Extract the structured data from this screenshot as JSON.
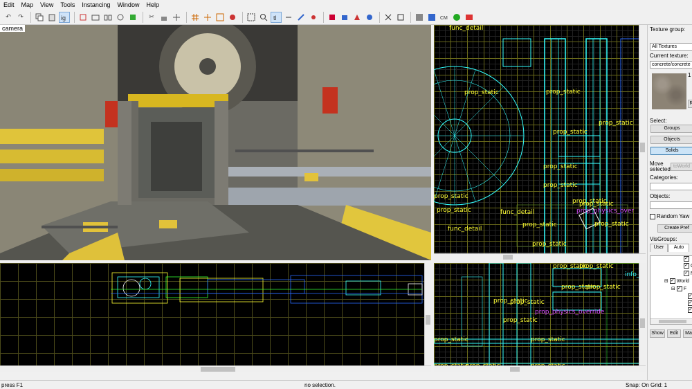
{
  "menu": [
    "Edit",
    "Map",
    "View",
    "Tools",
    "Instancing",
    "Window",
    "Help"
  ],
  "viewports": {
    "camera": {
      "label": "camera"
    },
    "top": {
      "labels": [
        "func_detail",
        "prop_static",
        "prop_static",
        "prop_static",
        "prop_static",
        "prop_static",
        "prop_static",
        "prop_static",
        "prop_static",
        "func_detail",
        "func_detail",
        "prop_static",
        "prop_static",
        "prop_static",
        "prop_static",
        "prop_static"
      ],
      "magenta_labels": [
        "prop_physics_over"
      ]
    },
    "side": {
      "labels": [
        "prop_static",
        "prop_static",
        "prop_static",
        "prop_static",
        "prop_static",
        "prop_static",
        "prop_static",
        "prop_static",
        "prop_static",
        "prop_static",
        "prop_static",
        "prop_static"
      ],
      "magenta_labels": [
        "prop_physics_override"
      ],
      "cyan_labels": [
        "info_plac"
      ]
    }
  },
  "side_panel": {
    "texture_group_label": "Texture group:",
    "texture_group_value": "All Textures",
    "current_texture_label": "Current texture:",
    "current_texture_value": "concrete/concrete",
    "texture_size": "1",
    "select_label": "Select:",
    "select_buttons": [
      "Groups",
      "Objects",
      "Solids"
    ],
    "move_selected_label_1": "Move",
    "move_selected_label_2": "selected",
    "to_world_button": "toWorld",
    "categories_label": "Categories:",
    "objects_label": "Objects:",
    "random_yaw_label": "Random Yaw",
    "create_prefab_button": "Create Pref",
    "visgroups_label": "VisGroups:",
    "visgroup_tabs": [
      "User",
      "Auto"
    ],
    "tree_items": [
      "C",
      "N",
      "World",
      "F"
    ],
    "bottom_buttons": [
      "Show",
      "Edit",
      "Ma"
    ],
    "r_button": "R"
  },
  "status": {
    "help": "press F1",
    "selection": "no selection.",
    "snap": "Snap: On Grid: 1"
  }
}
